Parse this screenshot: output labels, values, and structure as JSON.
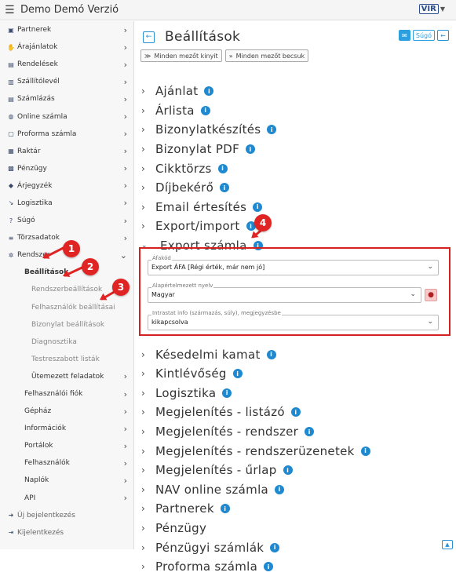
{
  "topbar": {
    "title": "Demo Demó Verzió",
    "logo_text": "VIR"
  },
  "sidebar": {
    "items": [
      {
        "label": "Partnerek",
        "icon": "address-book-icon",
        "glyph": "▣",
        "chevron": true,
        "level": 0
      },
      {
        "label": "Árajánlatok",
        "icon": "handshake-icon",
        "glyph": "✋",
        "chevron": true,
        "level": 0
      },
      {
        "label": "Rendelések",
        "icon": "document-icon",
        "glyph": "▤",
        "chevron": true,
        "level": 0
      },
      {
        "label": "Szállítólevél",
        "icon": "file-icon",
        "glyph": "▥",
        "chevron": true,
        "level": 0
      },
      {
        "label": "Számlázás",
        "icon": "invoice-icon",
        "glyph": "▤",
        "chevron": true,
        "level": 0
      },
      {
        "label": "Online számla",
        "icon": "globe-icon",
        "glyph": "◍",
        "chevron": true,
        "level": 0
      },
      {
        "label": "Proforma számla",
        "icon": "file-outline-icon",
        "glyph": "▢",
        "chevron": true,
        "level": 0
      },
      {
        "label": "Raktár",
        "icon": "warehouse-icon",
        "glyph": "▦",
        "chevron": true,
        "level": 0
      },
      {
        "label": "Pénzügy",
        "icon": "money-icon",
        "glyph": "▩",
        "chevron": true,
        "level": 0
      },
      {
        "label": "Árjegyzék",
        "icon": "tags-icon",
        "glyph": "◆",
        "chevron": true,
        "level": 0
      },
      {
        "label": "Logisztika",
        "icon": "dolly-icon",
        "glyph": "↘",
        "chevron": true,
        "level": 0
      },
      {
        "label": "Súgó",
        "icon": "question-icon",
        "glyph": "?",
        "chevron": true,
        "level": 0
      },
      {
        "label": "Törzsadatok",
        "icon": "database-icon",
        "glyph": "≡",
        "chevron": true,
        "level": 0
      },
      {
        "label": "Rendszer",
        "icon": "cogs-icon",
        "glyph": "✲",
        "chevron": "down",
        "level": 0
      },
      {
        "label": "Beállítások",
        "icon": "",
        "glyph": "",
        "chevron": false,
        "level": 1,
        "active": true
      },
      {
        "label": "Rendszerbeállítások",
        "icon": "",
        "glyph": "",
        "chevron": false,
        "level": 2
      },
      {
        "label": "Felhasználók beállításai",
        "icon": "",
        "glyph": "",
        "chevron": false,
        "level": 2
      },
      {
        "label": "Bizonylat beállítások",
        "icon": "",
        "glyph": "",
        "chevron": false,
        "level": 2
      },
      {
        "label": "Diagnosztika",
        "icon": "",
        "glyph": "",
        "chevron": false,
        "level": 2
      },
      {
        "label": "Testreszabott listák",
        "icon": "",
        "glyph": "",
        "chevron": false,
        "level": 2
      },
      {
        "label": "Ütemezett feladatok",
        "icon": "",
        "glyph": "",
        "chevron": true,
        "level": 2,
        "dark": true
      },
      {
        "label": "Felhasználói fiók",
        "icon": "",
        "glyph": "",
        "chevron": true,
        "level": 1
      },
      {
        "label": "Gépház",
        "icon": "",
        "glyph": "",
        "chevron": true,
        "level": 1
      },
      {
        "label": "Információk",
        "icon": "",
        "glyph": "",
        "chevron": true,
        "level": 1
      },
      {
        "label": "Portálok",
        "icon": "",
        "glyph": "",
        "chevron": true,
        "level": 1
      },
      {
        "label": "Felhasználók",
        "icon": "",
        "glyph": "",
        "chevron": true,
        "level": 1
      },
      {
        "label": "Naplók",
        "icon": "",
        "glyph": "",
        "chevron": true,
        "level": 1
      },
      {
        "label": "API",
        "icon": "",
        "glyph": "",
        "chevron": true,
        "level": 1
      },
      {
        "label": "Új bejelentkezés",
        "icon": "login-icon",
        "glyph": "➜",
        "chevron": false,
        "level": 0,
        "bottom": true
      },
      {
        "label": "Kijelentkezés",
        "icon": "logout-icon",
        "glyph": "⇥",
        "chevron": false,
        "level": 0,
        "bottom": true
      }
    ]
  },
  "header": {
    "title": "Beállítások",
    "help_label": "Súgó"
  },
  "toolbar": {
    "expand_label": "Minden mezőt kinyit",
    "collapse_label": "Minden mezőt becsuk"
  },
  "sections": [
    {
      "label": "Ajánlat",
      "info": true
    },
    {
      "label": "Árlista",
      "info": true
    },
    {
      "label": "Bizonylatkészítés",
      "info": true
    },
    {
      "label": "Bizonylat PDF",
      "info": true
    },
    {
      "label": "Cikktörzs",
      "info": true
    },
    {
      "label": "Díjbekérő",
      "info": true
    },
    {
      "label": "Email értesítés",
      "info": true
    },
    {
      "label": "Export/import",
      "info": true
    },
    {
      "label": "Export számla",
      "info": true,
      "open": true
    },
    {
      "label": "Késedelmi kamat",
      "info": true
    },
    {
      "label": "Kintlévőség",
      "info": true
    },
    {
      "label": "Logisztika",
      "info": true
    },
    {
      "label": "Megjelenítés - listázó",
      "info": true
    },
    {
      "label": "Megjelenítés - rendszer",
      "info": true
    },
    {
      "label": "Megjelenítés - rendszerüzenetek",
      "info": true
    },
    {
      "label": "Megjelenítés - űrlap",
      "info": true
    },
    {
      "label": "NAV online számla",
      "info": true
    },
    {
      "label": "Partnerek",
      "info": true
    },
    {
      "label": "Pénzügy",
      "info": false
    },
    {
      "label": "Pénzügyi számlák",
      "info": true
    },
    {
      "label": "Proforma számla",
      "info": true
    }
  ],
  "export_panel": {
    "afakod": {
      "label": "Áfakód",
      "value": "Export ÁFA [Régi érték, már nem jó]"
    },
    "nyelv": {
      "label": "Alapértelmezett nyelv",
      "value": "Magyar"
    },
    "intrastat": {
      "label": "Intrastat info (származás, súly), megjegyzésbe",
      "value": "kikapcsolva"
    }
  },
  "badges": [
    "1",
    "2",
    "3",
    "4"
  ],
  "colors": {
    "accent": "#1e88d0",
    "highlight": "#d32020"
  }
}
